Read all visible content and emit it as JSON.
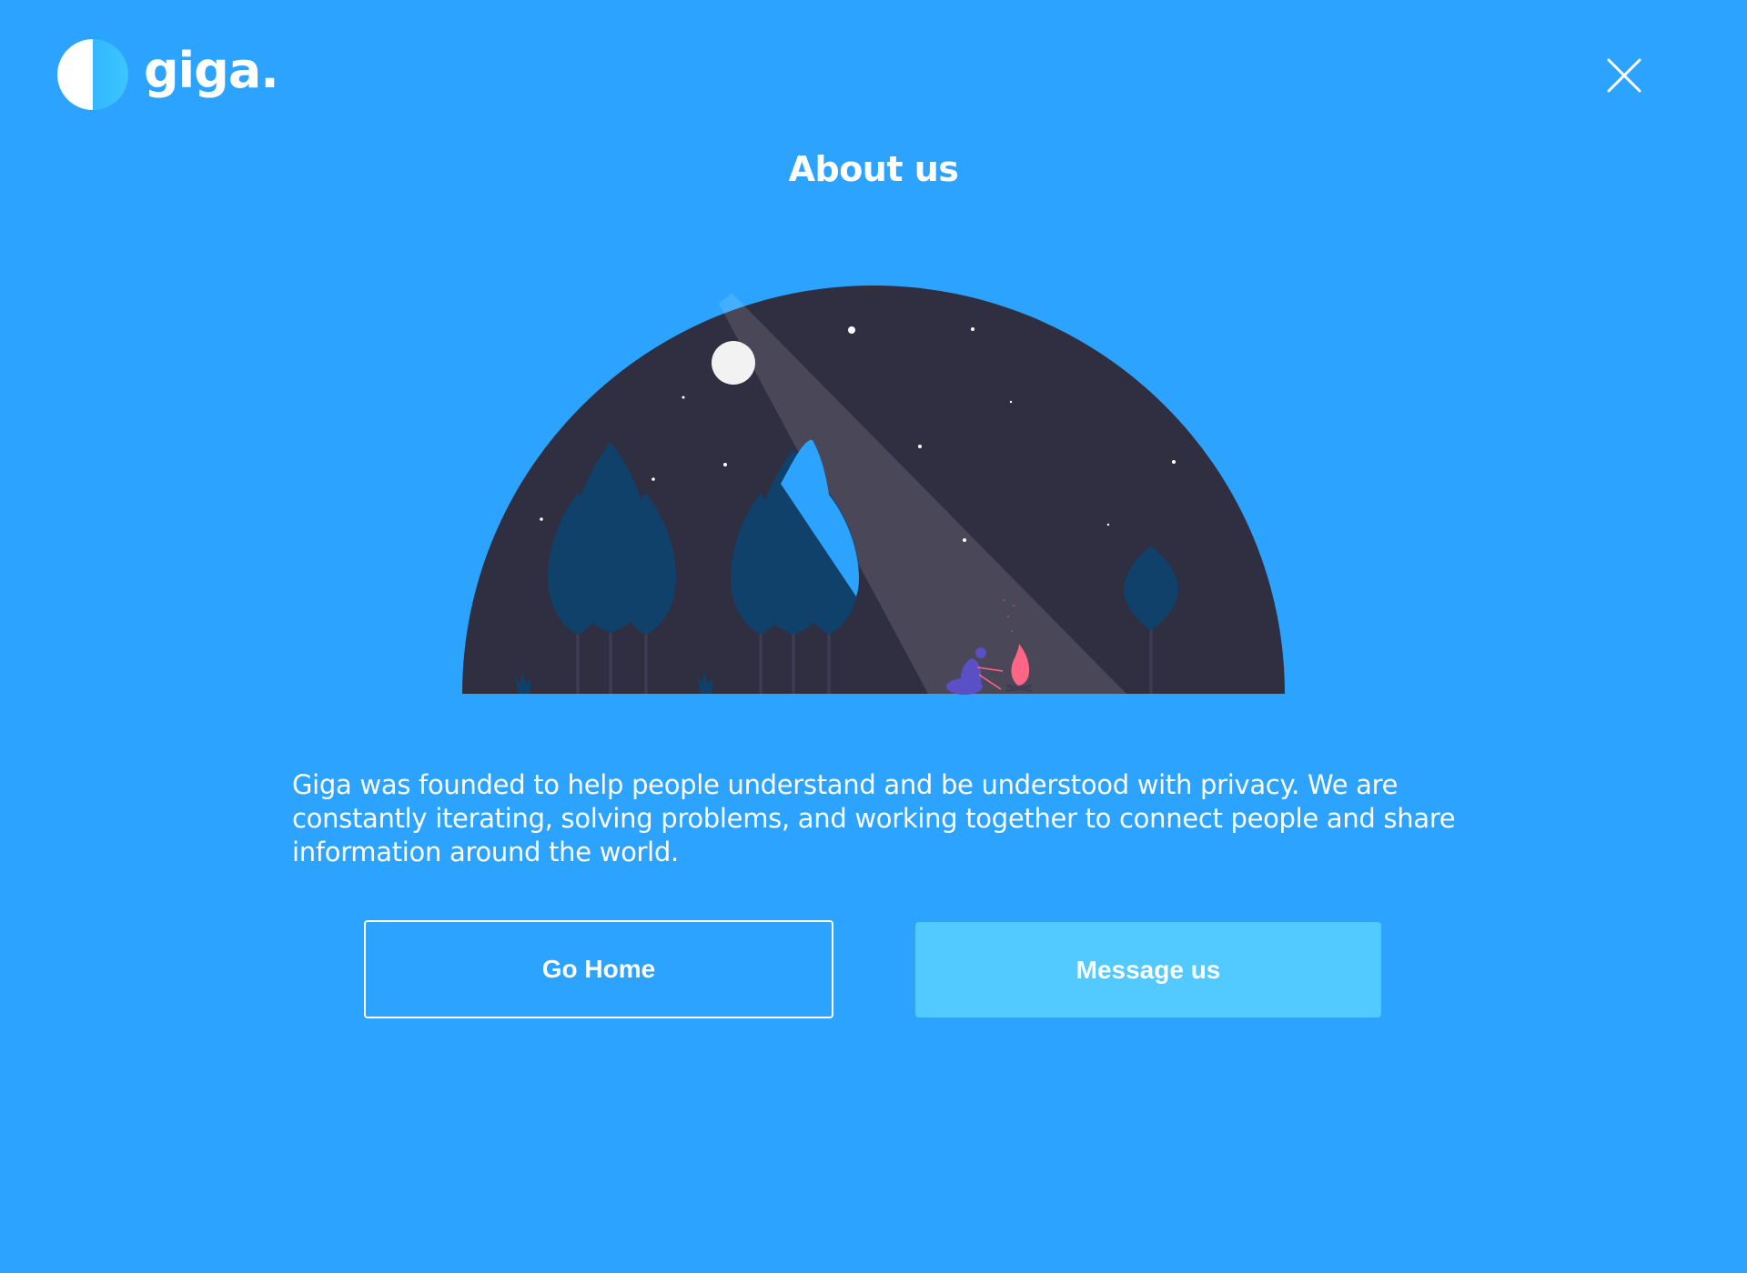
{
  "brand": {
    "name": "giga."
  },
  "header": {
    "close_icon": "close-icon"
  },
  "main": {
    "title": "About us",
    "description": "Giga was founded to help people understand and be understood with privacy. We are constantly iterating, solving problems, and working together to connect people and share information around the world.",
    "illustration_icon": "night-camping-illustration"
  },
  "actions": {
    "go_home_label": "Go Home",
    "message_label": "Message us"
  },
  "colors": {
    "background": "#2ca4ff",
    "button_accent": "#52c9ff",
    "night_sky": "#302e41",
    "tree": "#10416a",
    "fire": "#ff6584"
  }
}
